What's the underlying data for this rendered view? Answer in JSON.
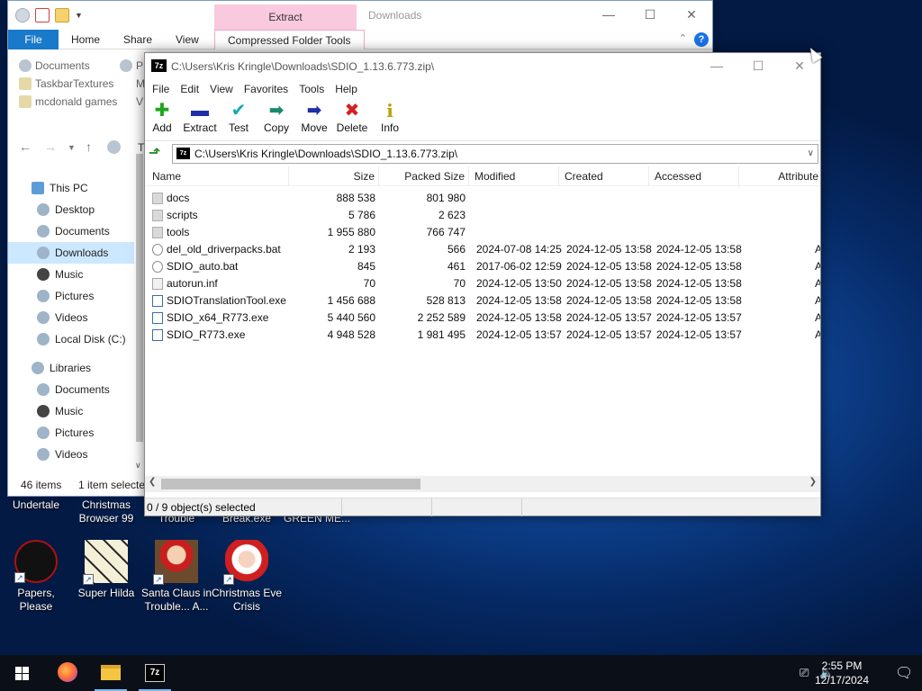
{
  "desktop": {
    "top_labels": [
      "Undertale",
      "Christmas Browser 99",
      "Trouble",
      "Break.exe",
      "GREEN ME..."
    ],
    "icons": [
      {
        "label": "Papers, Please",
        "icon": "papers-please-icon"
      },
      {
        "label": "Super Hilda",
        "icon": "super-hilda-icon"
      },
      {
        "label": "Santa Claus in Trouble... A...",
        "icon": "santa-claus-icon"
      },
      {
        "label": "Christmas Eve Crisis",
        "icon": "christmas-eve-crisis-icon"
      }
    ]
  },
  "explorer": {
    "title": "Downloads",
    "contextual_tab_header": "Extract",
    "tabs": [
      "File",
      "Home",
      "Share",
      "View",
      "Compressed Folder Tools"
    ],
    "quick_access": [
      "Documents",
      "TaskbarTextures",
      "mcdonald games"
    ],
    "quick_access_right": [
      "P",
      "M",
      "V"
    ],
    "address_fragment": "T",
    "tree": [
      {
        "label": "This PC",
        "level": 0
      },
      {
        "label": "Desktop",
        "level": 1
      },
      {
        "label": "Documents",
        "level": 1
      },
      {
        "label": "Downloads",
        "level": 1,
        "selected": true
      },
      {
        "label": "Music",
        "level": 1
      },
      {
        "label": "Pictures",
        "level": 1
      },
      {
        "label": "Videos",
        "level": 1
      },
      {
        "label": "Local Disk (C:)",
        "level": 1
      },
      {
        "label": "Libraries",
        "level": 0
      },
      {
        "label": "Documents",
        "level": 1
      },
      {
        "label": "Music",
        "level": 1
      },
      {
        "label": "Pictures",
        "level": 1
      },
      {
        "label": "Videos",
        "level": 1
      }
    ],
    "status_items": "46 items",
    "status_selected": "1 item selecte"
  },
  "zip": {
    "title": "C:\\Users\\Kris Kringle\\Downloads\\SDIO_1.13.6.773.zip\\",
    "menu": [
      "File",
      "Edit",
      "View",
      "Favorites",
      "Tools",
      "Help"
    ],
    "toolbar": [
      {
        "label": "Add",
        "icon": "add-icon",
        "glyph": "✚",
        "color": "#1fa51f"
      },
      {
        "label": "Extract",
        "icon": "extract-icon",
        "glyph": "▬",
        "color": "#1d2fa8"
      },
      {
        "label": "Test",
        "icon": "test-icon",
        "glyph": "✔",
        "color": "#18a8b8"
      },
      {
        "label": "Copy",
        "icon": "copy-icon",
        "glyph": "➡",
        "color": "#1a8a6e"
      },
      {
        "label": "Move",
        "icon": "move-icon",
        "glyph": "➡",
        "color": "#1d2fa8"
      },
      {
        "label": "Delete",
        "icon": "delete-icon",
        "glyph": "✖",
        "color": "#d42020"
      },
      {
        "label": "Info",
        "icon": "info-icon",
        "glyph": "i",
        "color": "#b8a200"
      }
    ],
    "address": "C:\\Users\\Kris Kringle\\Downloads\\SDIO_1.13.6.773.zip\\",
    "columns": [
      "Name",
      "Size",
      "Packed Size",
      "Modified",
      "Created",
      "Accessed",
      "Attribute"
    ],
    "files": [
      {
        "name": "docs",
        "type": "folder",
        "size": "888 538",
        "packed": "801 980",
        "modified": "",
        "created": "",
        "accessed": "",
        "attr": ""
      },
      {
        "name": "scripts",
        "type": "folder",
        "size": "5 786",
        "packed": "2 623",
        "modified": "",
        "created": "",
        "accessed": "",
        "attr": ""
      },
      {
        "name": "tools",
        "type": "folder",
        "size": "1 955 880",
        "packed": "766 747",
        "modified": "",
        "created": "",
        "accessed": "",
        "attr": ""
      },
      {
        "name": "del_old_driverpacks.bat",
        "type": "bat",
        "size": "2 193",
        "packed": "566",
        "modified": "2024-07-08 14:25",
        "created": "2024-12-05 13:58",
        "accessed": "2024-12-05 13:58",
        "attr": "A"
      },
      {
        "name": "SDIO_auto.bat",
        "type": "bat",
        "size": "845",
        "packed": "461",
        "modified": "2017-06-02 12:59",
        "created": "2024-12-05 13:58",
        "accessed": "2024-12-05 13:58",
        "attr": "A"
      },
      {
        "name": "autorun.inf",
        "type": "inf",
        "size": "70",
        "packed": "70",
        "modified": "2024-12-05 13:50",
        "created": "2024-12-05 13:58",
        "accessed": "2024-12-05 13:58",
        "attr": "A"
      },
      {
        "name": "SDIOTranslationTool.exe",
        "type": "exe",
        "size": "1 456 688",
        "packed": "528 813",
        "modified": "2024-12-05 13:58",
        "created": "2024-12-05 13:58",
        "accessed": "2024-12-05 13:58",
        "attr": "A"
      },
      {
        "name": "SDIO_x64_R773.exe",
        "type": "exe",
        "size": "5 440 560",
        "packed": "2 252 589",
        "modified": "2024-12-05 13:58",
        "created": "2024-12-05 13:57",
        "accessed": "2024-12-05 13:57",
        "attr": "A"
      },
      {
        "name": "SDIO_R773.exe",
        "type": "exe",
        "size": "4 948 528",
        "packed": "1 981 495",
        "modified": "2024-12-05 13:57",
        "created": "2024-12-05 13:57",
        "accessed": "2024-12-05 13:57",
        "attr": "A"
      }
    ],
    "status": "0 / 9 object(s) selected"
  },
  "taskbar": {
    "time": "2:55 PM",
    "date": "12/17/2024",
    "apps": [
      "firefox-icon",
      "file-explorer-icon",
      "7zip-icon"
    ]
  }
}
